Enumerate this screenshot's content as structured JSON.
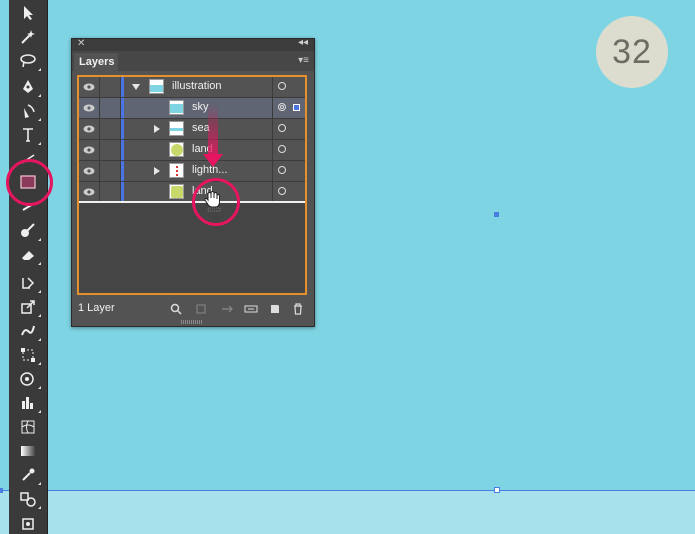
{
  "badge": {
    "number": "32"
  },
  "panel": {
    "tab_label": "Layers",
    "close_glyph": "✕",
    "collapse_glyph": "◂◂",
    "menu_glyph": "▾≡",
    "footer": {
      "layer_count": "1 Layer"
    },
    "rows": [
      {
        "label": "illustration",
        "expanded": true,
        "thumb": "sky-thumbnail",
        "selected": false
      },
      {
        "label": "sky",
        "expanded": null,
        "thumb": "sky-thumbnail",
        "selected": true
      },
      {
        "label": "sea",
        "expanded": false,
        "thumb": "sea-thumbnail",
        "selected": false
      },
      {
        "label": "land",
        "expanded": null,
        "thumb": "land-thumbnail",
        "selected": false
      },
      {
        "label": "lighth...",
        "expanded": false,
        "thumb": "lighthouse-thumbnail",
        "selected": false
      },
      {
        "label": "land",
        "expanded": null,
        "thumb": "land-thumbnail",
        "selected": false
      }
    ]
  },
  "colors": {
    "canvas": "#7fd4e4",
    "layer_color": "#4a74e4",
    "highlight": "#e5155f",
    "panel_outline": "#e5902b"
  },
  "icons": {
    "tools": [
      "selection-icon",
      "magic-wand-icon",
      "lasso-icon",
      "pen-icon",
      "add-anchor-icon",
      "type-icon",
      "line-icon",
      "rectangle-icon",
      "paintbrush-icon",
      "blob-brush-icon",
      "eraser-icon",
      "rotate-icon",
      "scale-icon",
      "warp-icon",
      "free-transform-icon",
      "symbol-sprayer-icon",
      "column-graph-icon",
      "mesh-icon",
      "gradient-icon",
      "eyedropper-icon",
      "blend-icon",
      "artboard-icon"
    ],
    "footer": [
      "search-icon",
      "collect-export-icon",
      "make-clipping-mask-icon",
      "create-sublayer-icon",
      "new-layer-icon",
      "trash-icon"
    ]
  }
}
